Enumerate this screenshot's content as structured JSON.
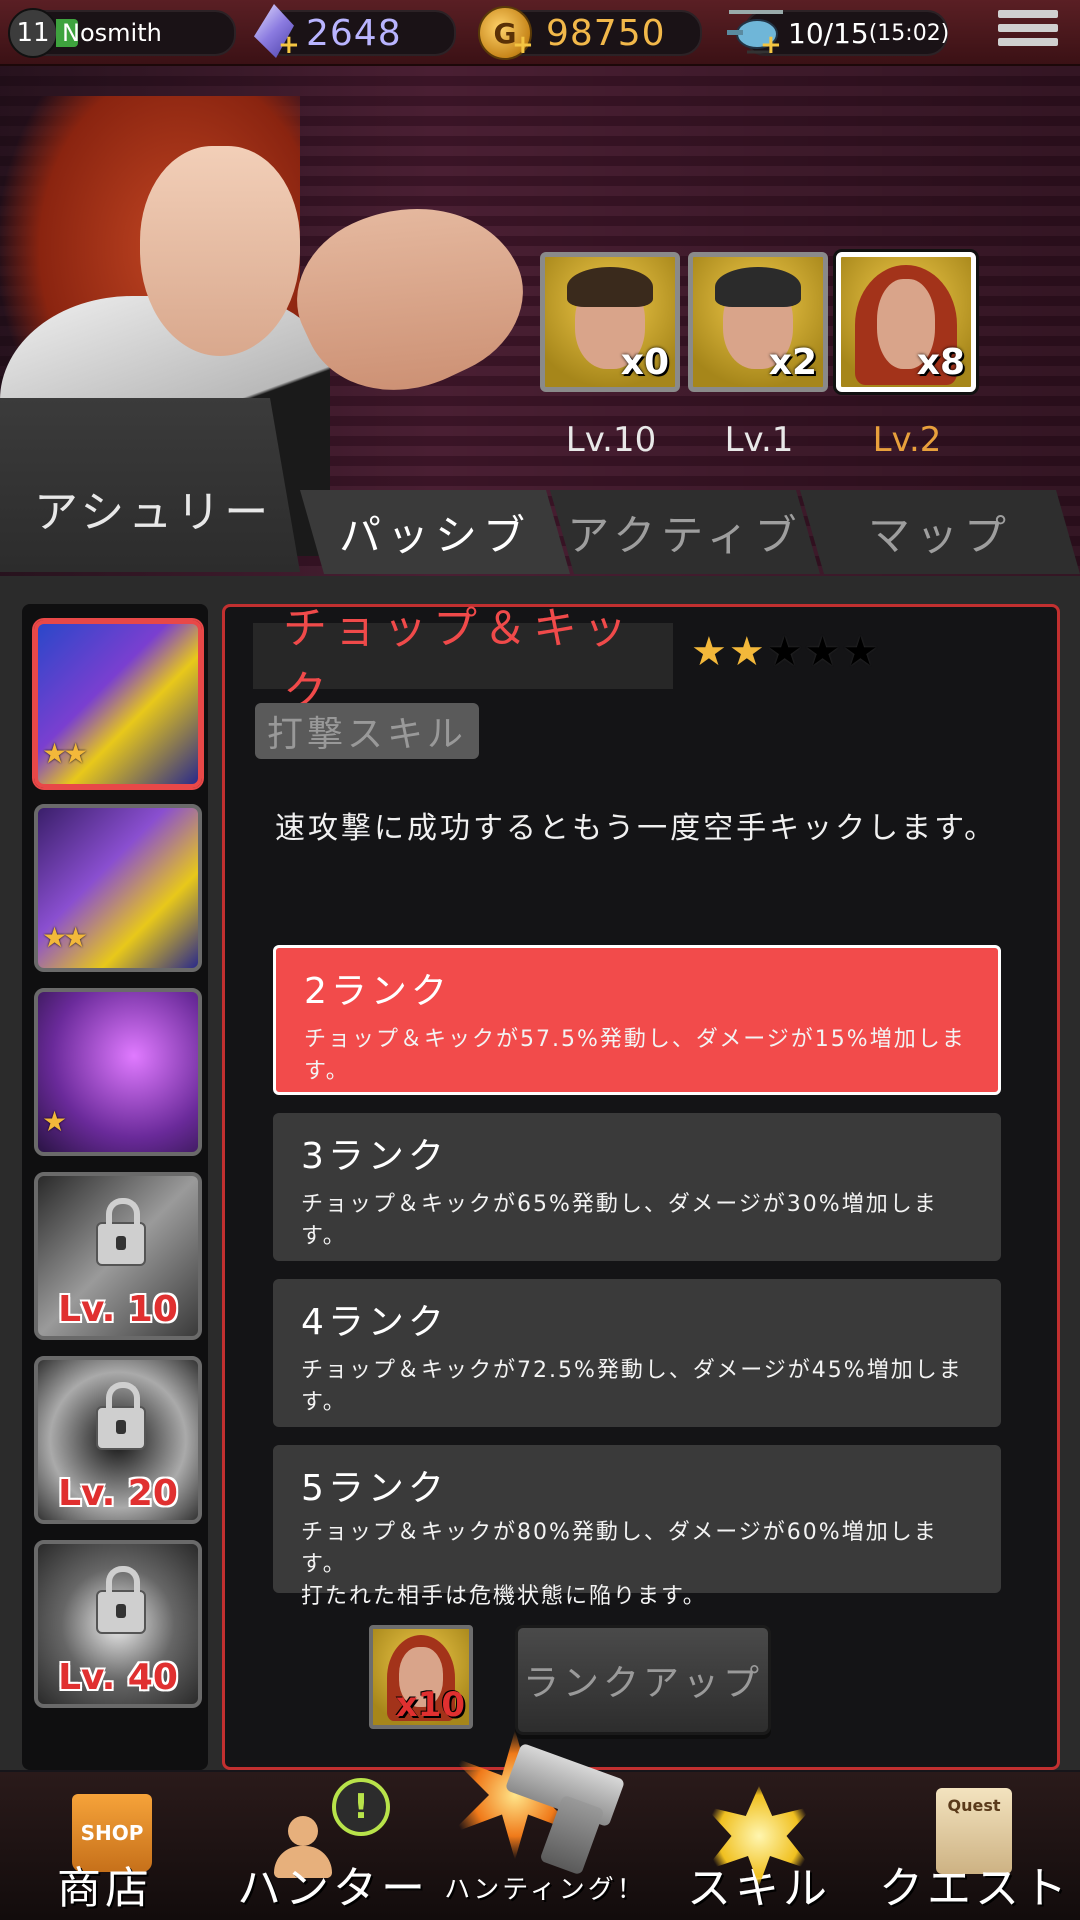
{
  "topbar": {
    "level": "11",
    "player_name": "Nosmith",
    "gems": "2648",
    "gold": "98750",
    "stamina": "10/15",
    "stamina_timer": "(15:02)"
  },
  "character": {
    "name": "アシュリー"
  },
  "hunters": [
    {
      "count": "x0",
      "level": "Lv.10",
      "selected": false
    },
    {
      "count": "x2",
      "level": "Lv.1",
      "selected": false
    },
    {
      "count": "x8",
      "level": "Lv.2",
      "selected": true
    }
  ],
  "tabs": [
    {
      "label": "パッシブ",
      "active": true
    },
    {
      "label": "アクティブ",
      "active": false
    },
    {
      "label": "マップ",
      "active": false
    }
  ],
  "skills_list": [
    {
      "stars": "★★",
      "locked": false,
      "selected": true
    },
    {
      "stars": "★★",
      "locked": false,
      "selected": false
    },
    {
      "stars": "★",
      "locked": false,
      "selected": false
    },
    {
      "lock_level": "Lv. 10",
      "locked": true
    },
    {
      "lock_level": "Lv. 20",
      "locked": true
    },
    {
      "lock_level": "Lv. 40",
      "locked": true
    }
  ],
  "skill": {
    "name": "チョップ＆キック",
    "stars_filled": 2,
    "stars_total": 5,
    "type": "打撃スキル",
    "description": "速攻撃に成功するともう一度空手キックします。",
    "ranks": [
      {
        "title": "2ランク",
        "text": "チョップ＆キックが57.5%発動し、ダメージが15%増加します。",
        "active": true
      },
      {
        "title": "3ランク",
        "text": "チョップ＆キックが65%発動し、ダメージが30%増加します。",
        "active": false
      },
      {
        "title": "4ランク",
        "text": "チョップ＆キックが72.5%発動し、ダメージが45%増加します。",
        "active": false
      },
      {
        "title": "5ランク",
        "text": "チョップ＆キックが80%発動し、ダメージが60%増加します。",
        "text2": "打たれた相手は危機状態に陥ります。",
        "active": false
      }
    ],
    "required_count": "x10",
    "rankup_label": "ランクアップ"
  },
  "bottom_nav": {
    "shop": "商店",
    "shop_bag_text": "SHOP",
    "hunter": "ハンター",
    "hunting": "ハンティング！",
    "skill": "スキル",
    "quest": "クエスト",
    "quest_scroll_text": "Quest"
  },
  "colors": {
    "accent_red": "#f24b4b",
    "star_gold": "#f3b83a",
    "selected_level": "#e8a03c"
  },
  "icons": [
    "gem-icon",
    "gold-coin-icon",
    "helicopter-icon",
    "menu-icon",
    "lock-icon",
    "shop-bag-icon",
    "hunter-icon",
    "gun-icon",
    "skill-icon",
    "quest-scroll-icon"
  ]
}
